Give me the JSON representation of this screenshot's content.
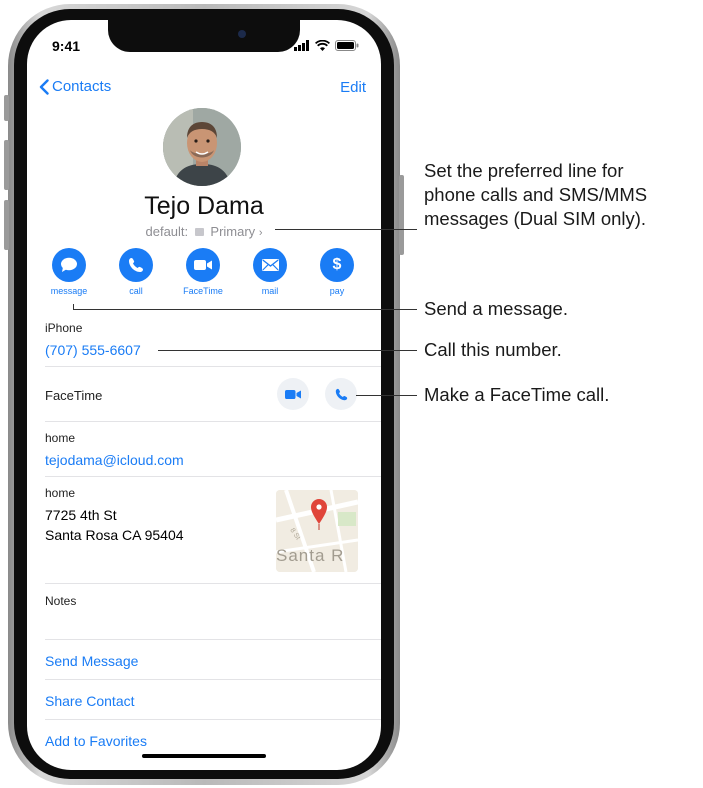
{
  "status_bar": {
    "time": "9:41"
  },
  "nav": {
    "back_label": "Contacts",
    "edit_label": "Edit"
  },
  "contact": {
    "name": "Tejo Dama",
    "default_label": "default:",
    "default_line": "Primary"
  },
  "actions": [
    {
      "label": "message",
      "icon": "message-icon"
    },
    {
      "label": "call",
      "icon": "phone-icon"
    },
    {
      "label": "FaceTime",
      "icon": "video-camera-icon"
    },
    {
      "label": "mail",
      "icon": "envelope-icon"
    },
    {
      "label": "pay",
      "icon": "dollar-icon"
    }
  ],
  "phone": {
    "label": "iPhone",
    "number": "(707) 555-6607"
  },
  "facetime": {
    "label": "FaceTime"
  },
  "email": {
    "label": "home",
    "address": "tejodama@icloud.com"
  },
  "address": {
    "label": "home",
    "line1": "7725 4th St",
    "line2": "Santa Rosa CA 95404",
    "map_text": "Santa R"
  },
  "notes": {
    "label": "Notes"
  },
  "links": {
    "send_message": "Send Message",
    "share_contact": "Share Contact",
    "add_to_favorites": "Add to Favorites"
  },
  "callouts": {
    "dual_sim": [
      "Set the preferred line for",
      "phone calls and SMS/MMS",
      "messages (Dual SIM only)."
    ],
    "send_message": "Send a message.",
    "call_number": "Call this number.",
    "facetime_call": "Make a FaceTime call."
  },
  "colors": {
    "accent": "#1a7cf5",
    "secondary_text": "#8e8e93",
    "map_pin": "#e0453a"
  }
}
